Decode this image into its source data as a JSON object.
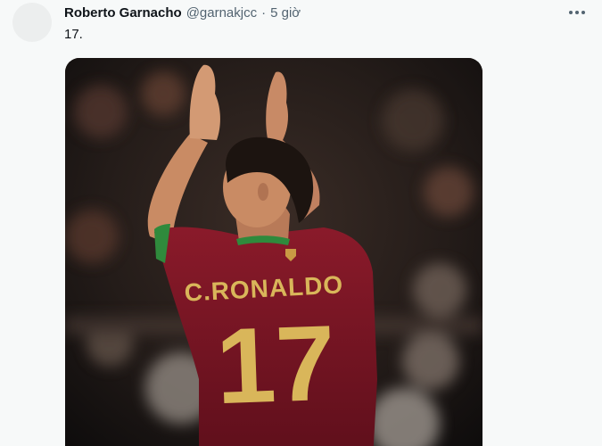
{
  "tweet": {
    "author_name": "Roberto Garnacho",
    "handle": "@garnakjcc",
    "separator": "·",
    "time": "5 giờ",
    "text": "17.",
    "more_icon": "more-horizontal-icon"
  },
  "media": {
    "jersey_name": "C.RONALDO",
    "jersey_number": "17",
    "colors": {
      "jersey": "#7a1624",
      "lettering": "#d9b65a",
      "collar": "#2f8a3c",
      "skin": "#c98b64",
      "hair": "#1c1410"
    }
  }
}
